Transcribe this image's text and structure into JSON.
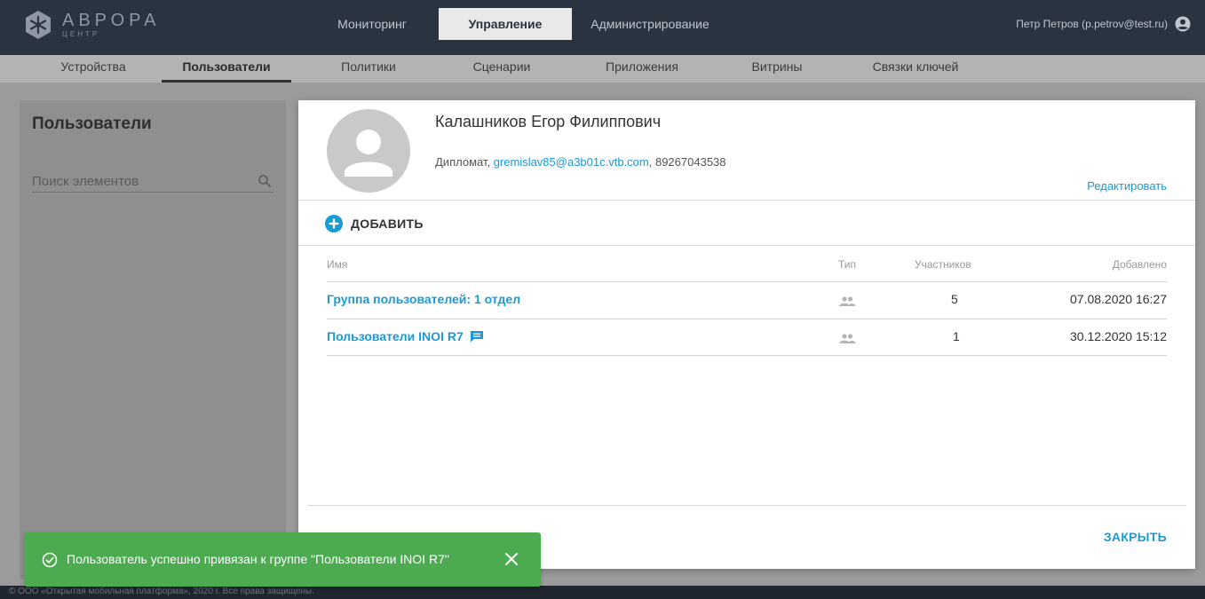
{
  "header": {
    "logo_name": "АВРОРА",
    "logo_sub": "ЦЕНТР",
    "tabs": [
      "Мониторинг",
      "Управление",
      "Администрирование"
    ],
    "active_tab": "Управление",
    "user": "Петр Петров (p.petrov@test.ru)",
    "user_icon": "account-circle-icon"
  },
  "subnav": {
    "items": [
      "Устройства",
      "Пользователи",
      "Политики",
      "Сценарии",
      "Приложения",
      "Витрины",
      "Связки ключей"
    ],
    "active": "Пользователи"
  },
  "left": {
    "title": "Пользователи",
    "search_placeholder": "Поиск элементов",
    "search_icon": "search-icon"
  },
  "modal": {
    "user_name": "Калашников Егор Филиппович",
    "role": "Дипломат, ",
    "email": "gremislav85@a3b01c.vtb.com",
    "phone": ", 89267043538",
    "edit_label": "Редактировать",
    "add_label": "ДОБАВИТЬ",
    "columns": {
      "name": "Имя",
      "type": "Тип",
      "members": "Участников",
      "added": "Добавлено"
    },
    "rows": [
      {
        "name": "Группа пользователей: 1 отдел",
        "type_icon": "group-icon",
        "members": "5",
        "added": "07.08.2020 16:27",
        "has_chat": false
      },
      {
        "name": "Пользователи INOI R7",
        "type_icon": "group-icon",
        "members": "1",
        "added": "30.12.2020 15:12",
        "has_chat": true
      }
    ],
    "close_label": "ЗАКРЫТЬ"
  },
  "toast": {
    "message": "Пользователь успешно привязан к группе \"Пользователи INOI R7\"",
    "icon": "check-circle-icon",
    "close_icon": "close-icon"
  },
  "footer": {
    "text": "© ООО «Открытая мобильная платформа», 2020 г. Все права защищены."
  },
  "colors": {
    "accent": "#1a9ad6",
    "header_bg": "#2a3340",
    "toast_bg": "#4caa50"
  }
}
